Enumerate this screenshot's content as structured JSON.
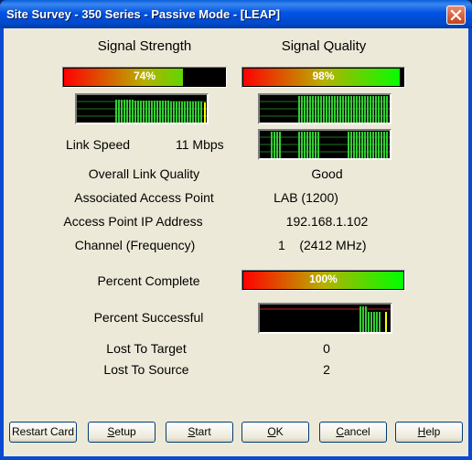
{
  "window": {
    "title": "Site Survey - 350 Series - Passive Mode - [LEAP]"
  },
  "headers": {
    "signal_strength": "Signal Strength",
    "signal_quality": "Signal Quality"
  },
  "signal_strength": {
    "percent_text": "74%",
    "percent": 74
  },
  "signal_quality": {
    "percent_text": "98%",
    "percent": 98
  },
  "link_speed": {
    "label": "Link Speed",
    "value": "11 Mbps"
  },
  "info": {
    "overall_link_quality": {
      "label": "Overall Link Quality",
      "value": "Good"
    },
    "associated_ap": {
      "label": "Associated Access Point",
      "value": "LAB (1200)"
    },
    "ap_ip": {
      "label": "Access Point IP Address",
      "value": "192.168.1.102"
    },
    "channel": {
      "label": "Channel (Frequency)",
      "value": "1    (2412 MHz)"
    }
  },
  "percent_complete": {
    "label": "Percent Complete",
    "percent_text": "100%",
    "percent": 100
  },
  "percent_successful": {
    "label": "Percent Successful"
  },
  "lost_to_target": {
    "label": "Lost To Target",
    "value": "0"
  },
  "lost_to_source": {
    "label": "Lost To Source",
    "value": "2"
  },
  "buttons": {
    "restart_card": "Restart Card",
    "setup": "etup",
    "setup_mnemonic": "S",
    "start": "tart",
    "start_mnemonic": "S",
    "ok": "K",
    "ok_mnemonic": "O",
    "cancel": "ancel",
    "cancel_mnemonic": "C",
    "help": "elp",
    "help_mnemonic": "H"
  },
  "colors": {
    "graph_bar": "#33cc33",
    "graph_grid": "#1a7a1a",
    "graph_marker": "#ffff00",
    "graph_line_red": "#cc2020"
  }
}
